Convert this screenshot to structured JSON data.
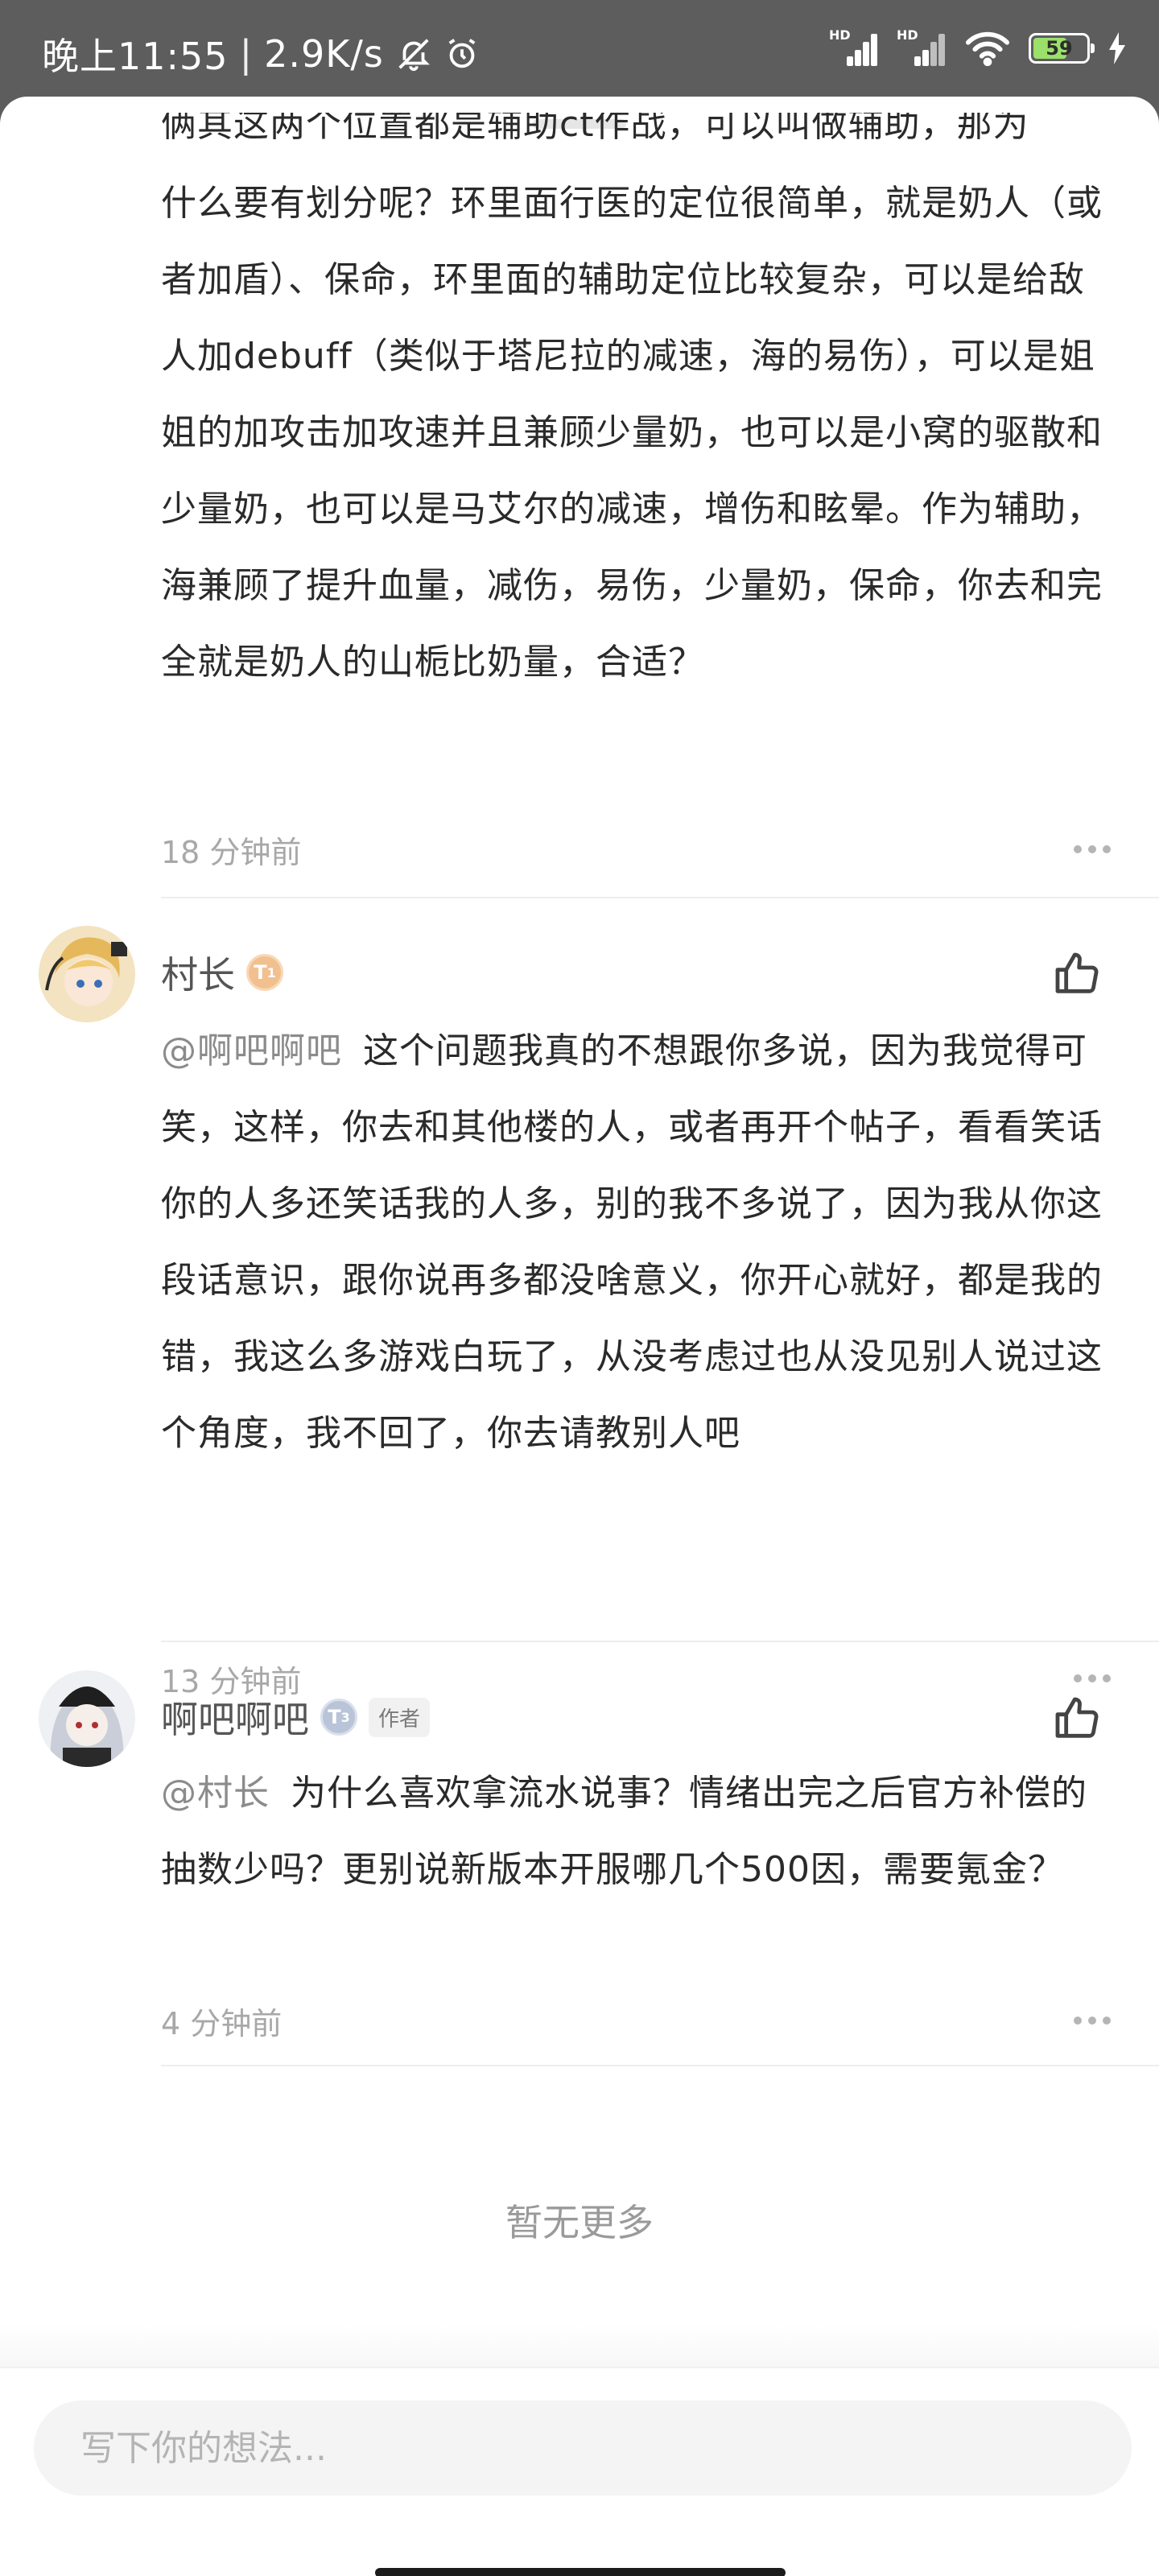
{
  "status_bar": {
    "time": "晚上11:55",
    "separator": "|",
    "speed": "2.9K/s",
    "battery": "59",
    "sim1_label": "HD",
    "sim2_label": "HD"
  },
  "first_reply": {
    "partial_top": "俩其这两个位置都是辅助ct作战，可以叫做辅助，那为",
    "text": "什么要有划分呢？环里面行医的定位很简单，就是奶人（或者加盾）、保命，环里面的辅助定位比较复杂，可以是给敌人加debuff（类似于塔尼拉的减速，海的易伤），可以是姐姐的加攻击加攻速并且兼顾少量奶，也可以是小窝的驱散和少量奶，也可以是马艾尔的减速，增伤和眩晕。作为辅助，海兼顾了提升血量，减伤，易伤，少量奶，保命，你去和完全就是奶人的山栀比奶量，合适？",
    "time": "18 分钟前"
  },
  "comments": [
    {
      "name": "村长",
      "level": "1",
      "mention": "@啊吧啊吧",
      "text": "这个问题我真的不想跟你多说，因为我觉得可笑，这样，你去和其他楼的人，或者再开个帖子，看看笑话你的人多还笑话我的人多，别的我不多说了，因为我从你这段话意识，跟你说再多都没啥意义，你开心就好，都是我的错，我这么多游戏白玩了，从没考虑过也从没见别人说过这个角度，我不回了，你去请教别人吧",
      "time": "13 分钟前"
    },
    {
      "name": "啊吧啊吧",
      "level": "3",
      "badge": "作者",
      "mention": "@村长",
      "text": "为什么喜欢拿流水说事？情绪出完之后官方补偿的抽数少吗？更别说新版本开服哪几个500因，需要氪金？",
      "time": "4 分钟前"
    }
  ],
  "no_more": "暂无更多",
  "input": {
    "placeholder": "写下你的想法..."
  },
  "colors": {
    "status_bg": "#5d5d5d",
    "battery_fill": "#9be06a",
    "meta": "#a8a8a8"
  }
}
